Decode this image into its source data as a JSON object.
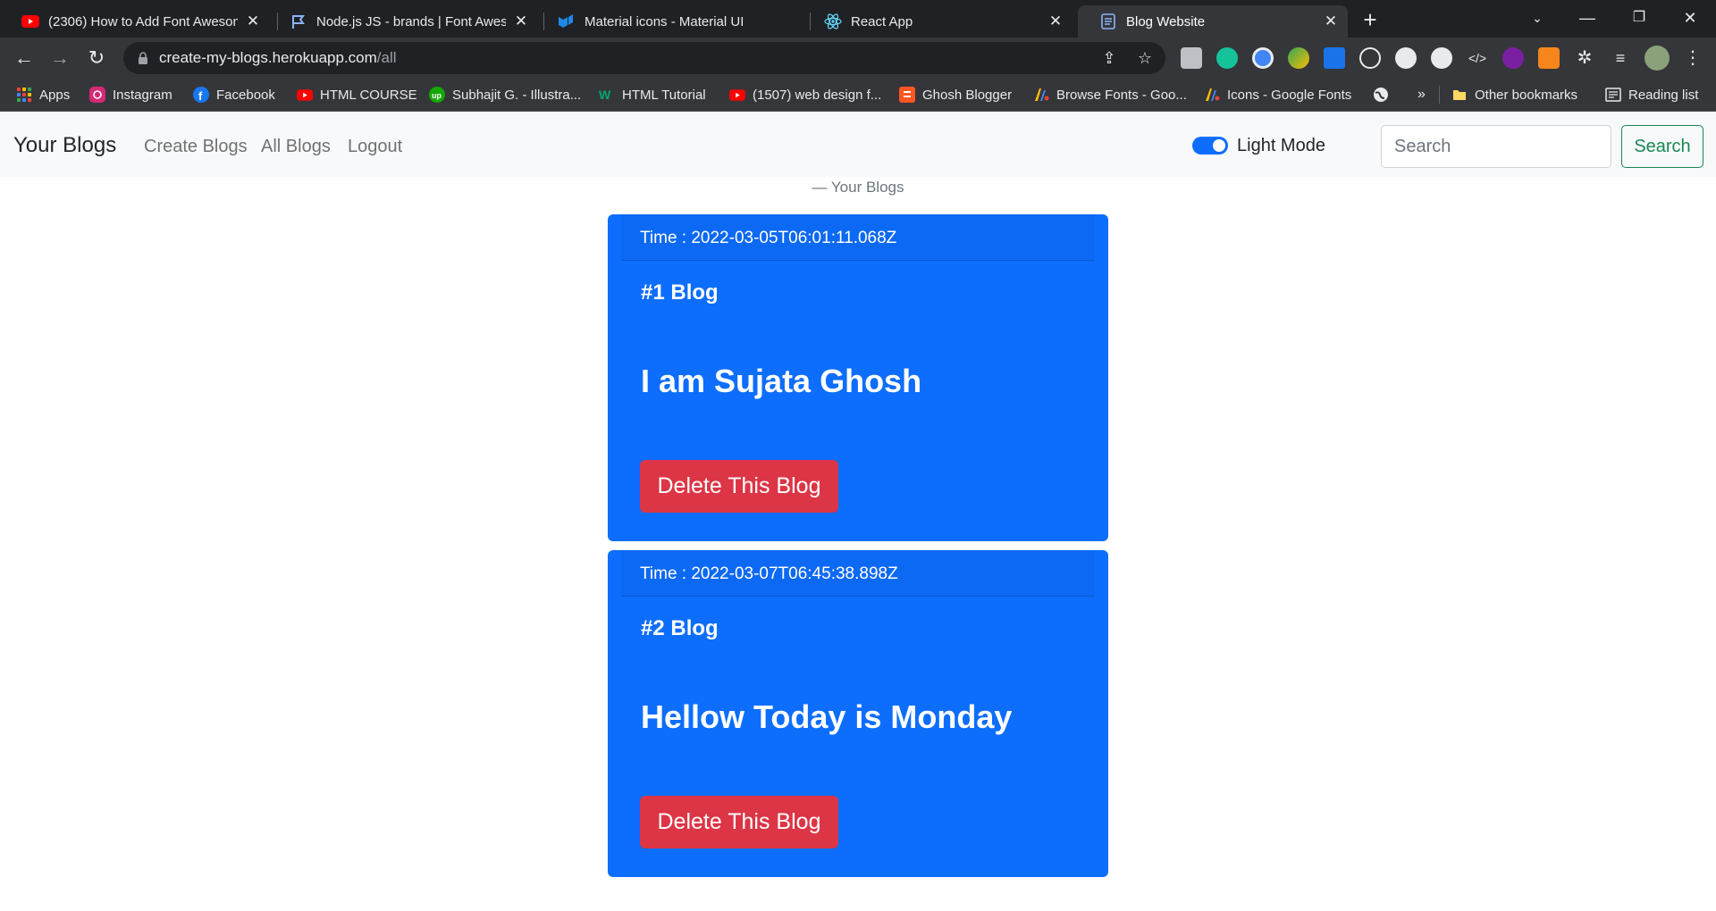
{
  "browser": {
    "tabs": [
      {
        "title": "(2306) How to Add Font Awesom",
        "icon": "youtube-icon",
        "active": false
      },
      {
        "title": "Node.js JS - brands | Font Aweso",
        "icon": "flag-icon",
        "active": false
      },
      {
        "title": "Material icons - Material UI",
        "icon": "mui-icon",
        "active": false
      },
      {
        "title": "React App",
        "icon": "react-icon",
        "active": false
      },
      {
        "title": "Blog Website",
        "icon": "page-icon",
        "active": true
      }
    ],
    "url_main": "create-my-blogs.herokuapp.com",
    "url_path": "/all",
    "bookmarks": [
      {
        "label": "Apps",
        "icon": "apps-grid-icon"
      },
      {
        "label": "Instagram",
        "icon": "instagram-icon"
      },
      {
        "label": "Facebook",
        "icon": "facebook-icon"
      },
      {
        "label": "HTML COURSE",
        "icon": "youtube-icon"
      },
      {
        "label": "Subhajit G. - Illustra...",
        "icon": "upwork-icon"
      },
      {
        "label": "HTML Tutorial",
        "icon": "w3schools-icon"
      },
      {
        "label": "(1507) web design f...",
        "icon": "youtube-icon"
      },
      {
        "label": "Ghosh Blogger",
        "icon": "blogger-icon"
      },
      {
        "label": "Browse Fonts - Goo...",
        "icon": "google-fonts-icon"
      },
      {
        "label": "Icons - Google Fonts",
        "icon": "google-fonts-icon"
      },
      {
        "label": "",
        "icon": "globe-icon"
      }
    ],
    "more_bookmarks": "»",
    "other_bookmarks": "Other bookmarks",
    "reading_list": "Reading list"
  },
  "navbar": {
    "brand": "Your Blogs",
    "links": [
      "Create Blogs",
      "All Blogs",
      "Logout"
    ],
    "toggle_label": "Light Mode",
    "toggle_on": true,
    "search_placeholder": "Search",
    "search_button": "Search"
  },
  "page": {
    "breadcrumb": "— Your Blogs"
  },
  "blogs": [
    {
      "time": "Time : 2022-03-05T06:01:11.068Z",
      "title": "#1 Blog",
      "text": "I am Sujata Ghosh",
      "delete_label": "Delete This Blog"
    },
    {
      "time": "Time : 2022-03-07T06:45:38.898Z",
      "title": "#2 Blog",
      "text": "Hellow Today is Monday",
      "delete_label": "Delete This Blog"
    }
  ],
  "colors": {
    "primary": "#0d6efd",
    "danger": "#dc3545",
    "success": "#198754",
    "navbar_bg": "#f8f9fa"
  }
}
